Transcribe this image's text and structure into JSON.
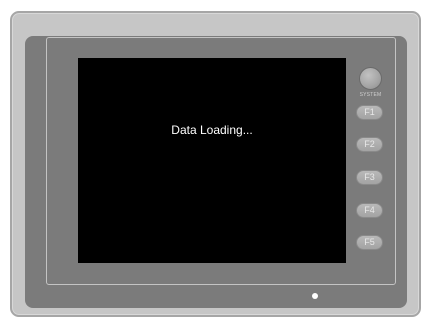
{
  "screen": {
    "message": "Data Loading..."
  },
  "system_button": {
    "label": "SYSTEM"
  },
  "function_keys": [
    {
      "label": "F1"
    },
    {
      "label": "F2"
    },
    {
      "label": "F3"
    },
    {
      "label": "F4"
    },
    {
      "label": "F5"
    }
  ],
  "colors": {
    "screen_background": "#000000",
    "screen_text": "#ffffff",
    "bezel": "#7b7b7b",
    "outer_case": "#c6c6c6",
    "status_led": "#ffffff"
  },
  "icons": {
    "status_led": "led-indicator-icon"
  }
}
